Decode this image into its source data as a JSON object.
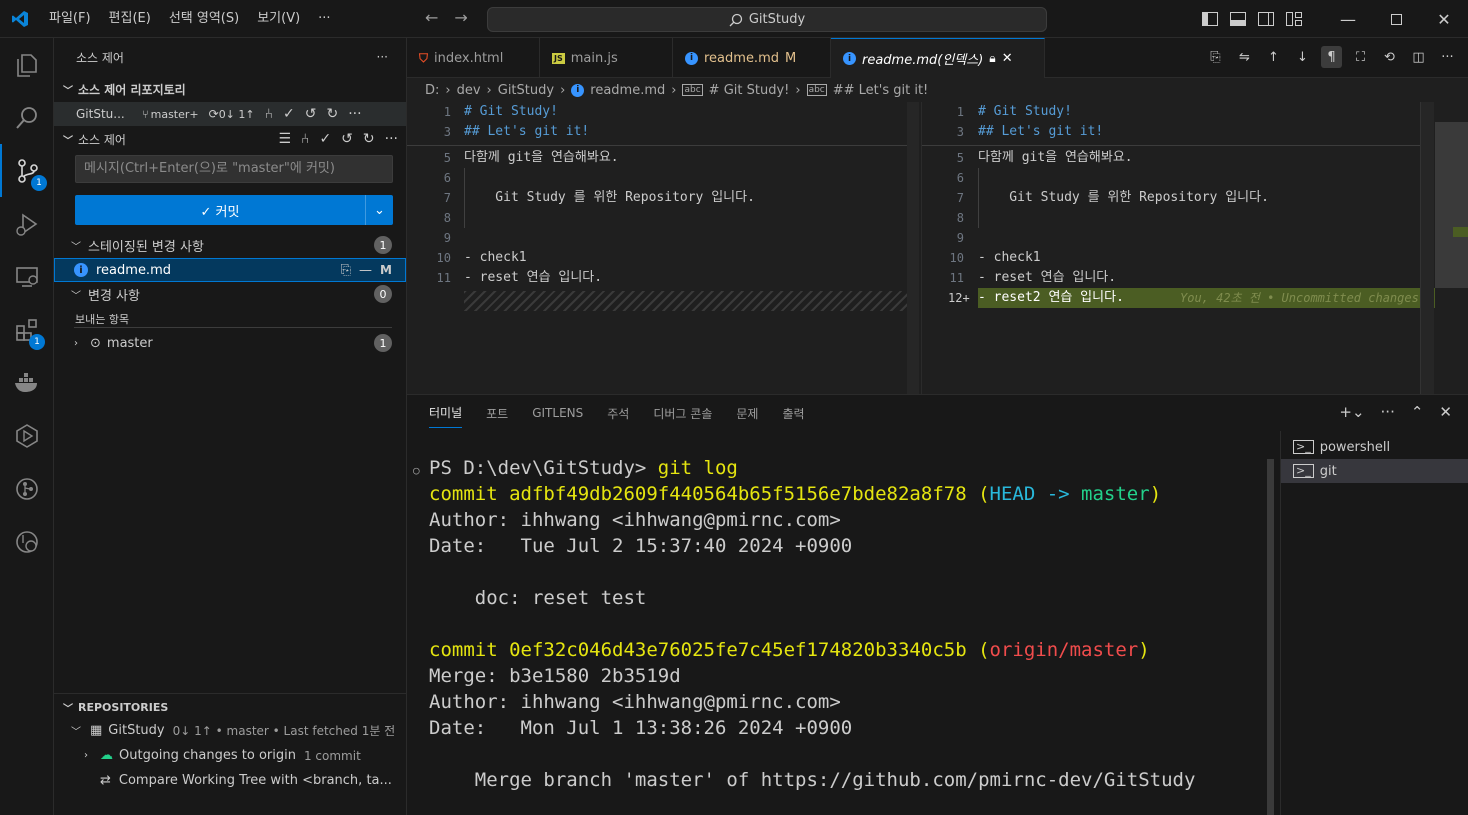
{
  "titlebar": {
    "menu": [
      "파일(F)",
      "편집(E)",
      "선택 영역(S)",
      "보기(V)",
      "···"
    ],
    "search_text": "GitStudy"
  },
  "activity": {
    "scm_badge": "1",
    "extensions_badge": "1"
  },
  "sidebar": {
    "title": "소스 제어",
    "more": "···",
    "repos_header": "소스 제어 리포지토리",
    "repo_name": "GitStu...",
    "repo_branch": "master+",
    "repo_sync": "0↓ 1↑",
    "scm_header": "소스 제어",
    "commit_placeholder": "메시지(Ctrl+Enter(으)로 \"master\"에 커밋)",
    "commit_label": "✓ 커밋",
    "staged_label": "스테이징된 변경 사항",
    "staged_count": "1",
    "staged_file": "readme.md",
    "staged_file_status": "M",
    "changes_label": "변경 사항",
    "changes_count": "0",
    "outgoing_label": "보내는 항목",
    "outgoing_branch": "master",
    "outgoing_count": "1",
    "repositories": {
      "header": "REPOSITORIES",
      "repo": "GitStudy",
      "repo_meta": "0↓ 1↑ • master • Last fetched 1분 전",
      "outgoing": "Outgoing changes to origin",
      "outgoing_meta": "1 commit",
      "compare": "Compare Working Tree with <branch, ta..."
    }
  },
  "tabs": [
    {
      "label": "index.html",
      "status": ""
    },
    {
      "label": "main.js",
      "status": ""
    },
    {
      "label": "readme.md",
      "status": "M"
    },
    {
      "label": "readme.md(인덱스)",
      "status": ""
    }
  ],
  "breadcrumb": [
    "D:",
    "dev",
    "GitStudy",
    "readme.md",
    "# Git Study!",
    "## Let's git it!"
  ],
  "editor_left": {
    "lines": [
      {
        "n": "1",
        "text": "# Git Study!"
      },
      {
        "n": "3",
        "text": "## Let's git it!"
      },
      {
        "n": "5",
        "text": "다함께 git을 연습해봐요."
      },
      {
        "n": "6",
        "text": ""
      },
      {
        "n": "7",
        "text": "    Git Study 를 위한 Repository 입니다."
      },
      {
        "n": "8",
        "text": ""
      },
      {
        "n": "9",
        "text": ""
      },
      {
        "n": "10",
        "text": "- check1"
      },
      {
        "n": "11",
        "text": "- reset 연습 입니다."
      }
    ]
  },
  "editor_right": {
    "lines": [
      {
        "n": "1",
        "text": "# Git Study!"
      },
      {
        "n": "3",
        "text": "## Let's git it!"
      },
      {
        "n": "5",
        "text": "다함께 git을 연습해봐요."
      },
      {
        "n": "6",
        "text": ""
      },
      {
        "n": "7",
        "text": "    Git Study 를 위한 Repository 입니다."
      },
      {
        "n": "8",
        "text": ""
      },
      {
        "n": "9",
        "text": ""
      },
      {
        "n": "10",
        "text": "- check1"
      },
      {
        "n": "11",
        "text": "- reset 연습 입니다."
      },
      {
        "n": "12+",
        "text": "- reset2 연습 입니다."
      }
    ],
    "blame": "You, 42초 전 • Uncommitted changes"
  },
  "panel": {
    "tabs": [
      "터미널",
      "포트",
      "GITLENS",
      "주석",
      "디버그 콘솔",
      "문제",
      "출력"
    ],
    "terminals": [
      "powershell",
      "git"
    ],
    "lines": {
      "prompt": "PS D:\\dev\\GitStudy> ",
      "cmd": "git log",
      "c1_commit": "commit adfbf49db2609f440564b65f5156e7bde82a8f78 ",
      "c1_head": "HEAD -> ",
      "c1_branch": "master",
      "c1_author": "Author: ihhwang <ihhwang@pmirnc.com>",
      "c1_date": "Date:   Tue Jul 2 15:37:40 2024 +0900",
      "c1_msg": "    doc: reset test",
      "c2_commit": "commit 0ef32c046d43e76025fe7c45ef174820b3340c5b ",
      "c2_ref": "origin/master",
      "c2_merge": "Merge: b3e1580 2b3519d",
      "c2_author": "Author: ihhwang <ihhwang@pmirnc.com>",
      "c2_date": "Date:   Mon Jul 1 13:38:26 2024 +0900",
      "c2_msg": "    Merge branch 'master' of https://github.com/pmirnc-dev/GitStudy"
    }
  },
  "colors": {
    "accent": "#0078d4",
    "added_line": "#4b5d23",
    "term_yellow": "#e5e510",
    "term_cyan": "#29b8db",
    "term_green": "#23d18b",
    "term_red": "#f14c4c"
  }
}
